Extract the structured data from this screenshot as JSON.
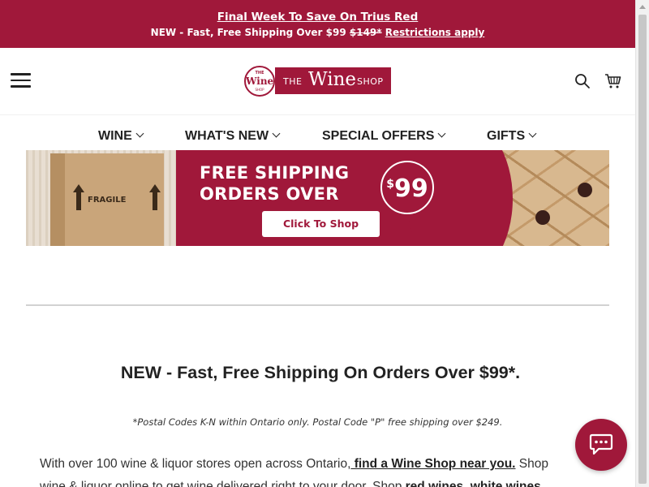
{
  "promo": {
    "title": "Final Week To Save On Trius Red",
    "shipping_prefix": "NEW - Fast, Free Shipping Over $99",
    "old_price": "$149*",
    "restrictions_link": "Restrictions apply"
  },
  "header": {
    "menu_icon": "hamburger-icon",
    "logo": {
      "circle_the": "THE",
      "circle_wine": "Wine",
      "circle_shop": "SHOP",
      "band_the": "THE",
      "band_wine": "Wine",
      "band_shop": "SHOP"
    },
    "search_icon": "search-icon",
    "cart_icon": "cart-icon"
  },
  "nav": {
    "items": [
      {
        "label": "WINE"
      },
      {
        "label": "WHAT'S NEW"
      },
      {
        "label": "SPECIAL OFFERS"
      },
      {
        "label": "GIFTS"
      }
    ]
  },
  "banner": {
    "headline_line1": "FREE SHIPPING",
    "headline_line2": "ORDERS OVER",
    "badge_dollar": "$",
    "badge_amount": "99",
    "box_label": "FRAGILE",
    "cta": "Click To Shop"
  },
  "content": {
    "headline": "NEW - Fast, Free Shipping On Orders Over $99*.",
    "note": "*Postal Codes K-N within Ontario only. Postal Code \"P\" free shipping over $249.",
    "para_line1_text": "With over 100 wine & liquor stores open across Ontario,",
    "para_line1_link": " find a Wine Shop near you.",
    "para_line1_tail": " Shop",
    "para_line2_text": "wine & liquor online to get wine delivered right to your door. Shop ",
    "para_line2_bold1": "red wines",
    "para_line2_sep": ", ",
    "para_line2_bold2": "white wines"
  },
  "chat": {
    "icon": "chat-icon"
  },
  "colors": {
    "brand": "#a0183a",
    "text": "#222222",
    "divider": "#d2d2d2"
  }
}
